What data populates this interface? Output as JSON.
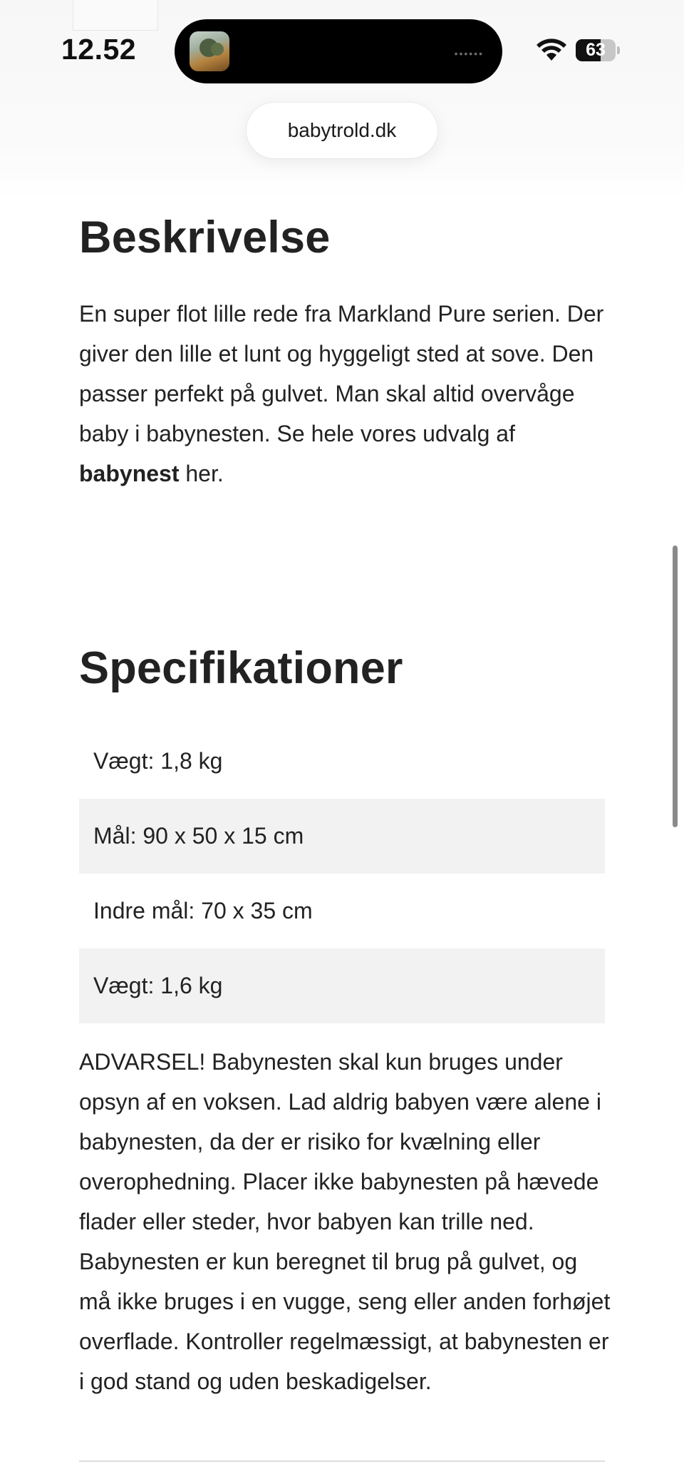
{
  "status_bar": {
    "time": "12.52",
    "battery_level": "63",
    "battery_fraction": 0.63,
    "island_dots": "••••••"
  },
  "browser": {
    "url": "babytrold.dk"
  },
  "description": {
    "heading": "Beskrivelse",
    "text_before": "En super flot lille rede fra Markland Pure serien. Der giver den lille et lunt og hyggeligt sted at sove. Den passer perfekt på gulvet. Man skal altid overvåge baby i babynesten. Se hele vores udvalg af ",
    "link_text": "babynest",
    "text_after": " her."
  },
  "specifications": {
    "heading": "Specifikationer",
    "rows": [
      "Vægt: 1,8 kg",
      "Mål: 90 x 50 x 15 cm",
      "Indre mål: 70 x 35 cm",
      "Vægt: 1,6 kg"
    ]
  },
  "warning": {
    "text": "ADVARSEL! Babynesten skal kun bruges under opsyn af en voksen. Lad aldrig babyen være alene i babynesten, da der er risiko for kvælning eller overophedning. Placer ikke babynesten på hævede flader eller steder, hvor babyen kan trille ned. Babynesten er kun beregnet til brug på gulvet, og må ikke bruges i en vugge, seng eller anden forhøjet overflade. Kontroller regelmæssigt, at babynesten er i god stand og uden beskadigelser."
  },
  "colors": {
    "text": "#222222",
    "row_shade": "#f2f2f2",
    "island": "#000000"
  }
}
